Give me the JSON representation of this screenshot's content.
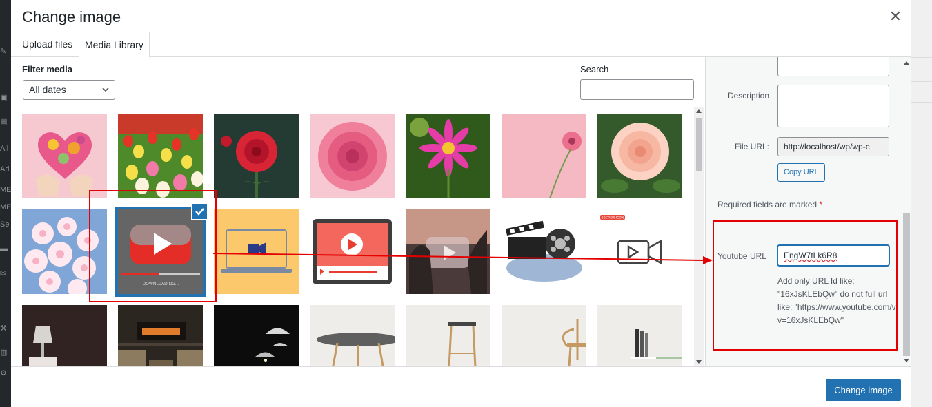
{
  "dialog": {
    "title": "Change image",
    "close_icon": "close-icon"
  },
  "tabs": [
    {
      "label": "Upload files",
      "active": false
    },
    {
      "label": "Media Library",
      "active": true
    }
  ],
  "filters": {
    "filter_label": "Filter media",
    "date_select": "All dates",
    "search_label": "Search",
    "search_value": ""
  },
  "media_grid": {
    "rows": [
      [
        "heart of flowers held by hands",
        "tulip field",
        "red dahlia",
        "pink rose",
        "pink dahlia",
        "pink gerbera on pink",
        "peach rose"
      ],
      [
        "white daisies",
        "youtube video thumbnail",
        "video camera icon on laptop",
        "video player on tablet",
        "hands framing video icon",
        "film reel and clapperboard",
        "video play icon"
      ],
      [
        "dark interior lamp",
        "living room fireplace",
        "pendant lamp dark",
        "round table",
        "wooden stool",
        "wooden chair",
        "bookshelf"
      ]
    ],
    "selected": {
      "row": 1,
      "col": 1
    },
    "selected_caption": "DOWNLOADING...",
    "thumb_badge": "SECTION ICON"
  },
  "details": {
    "description_label": "Description",
    "file_url_label": "File URL:",
    "file_url_value": "http://localhost/wp/wp-c",
    "copy_url_label": "Copy URL",
    "required_text": "Required fields are marked",
    "required_star": "*",
    "youtube_label": "Youtube URL",
    "youtube_value": "EngW7tLk6R8",
    "youtube_help": "Add only URL Id like: \"16xJsKLEbQw\" do not full url like: \"https://www.youtube.com/v v=16xJsKLEbQw\""
  },
  "footer": {
    "primary_button": "Change image"
  },
  "colors": {
    "accent": "#2271b1",
    "annotation_red": "#e40000",
    "sidebar_bg": "#f6f7f7"
  }
}
